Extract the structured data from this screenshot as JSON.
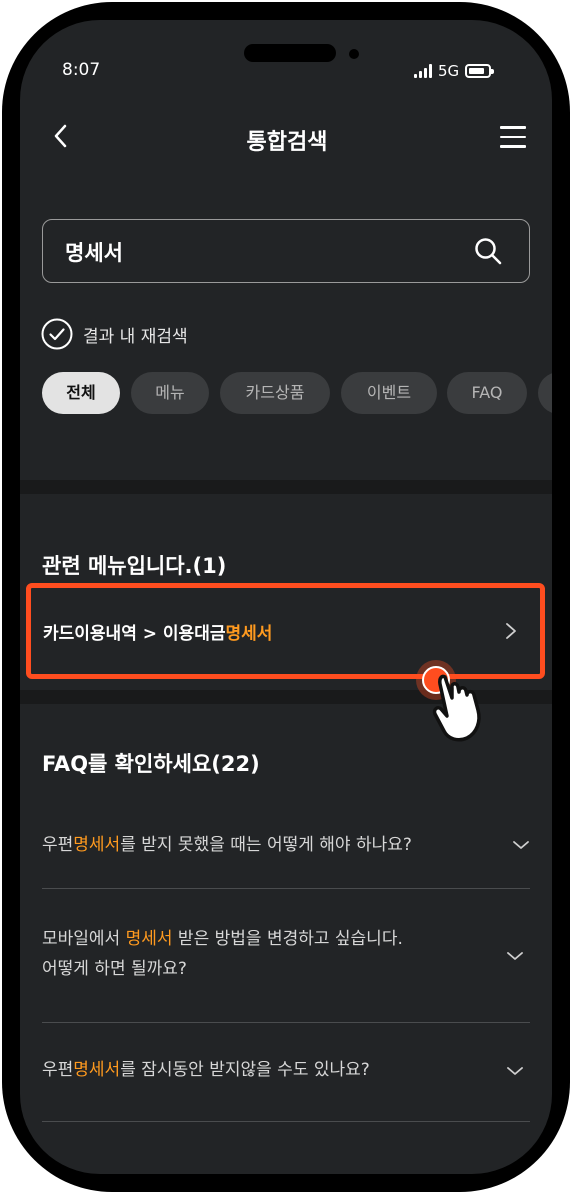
{
  "status": {
    "time": "8:07",
    "network": "5G"
  },
  "header": {
    "title": "통합검색"
  },
  "search": {
    "query": "명세서"
  },
  "recheck": {
    "label": "결과 내 재검색",
    "checked": true
  },
  "chips": [
    {
      "label": "전체",
      "active": true
    },
    {
      "label": "메뉴",
      "active": false
    },
    {
      "label": "카드상품",
      "active": false
    },
    {
      "label": "이벤트",
      "active": false
    },
    {
      "label": "FAQ",
      "active": false
    }
  ],
  "menu_section": {
    "title": "관련 메뉴입니다.(1)",
    "result": {
      "prefix": "카드이용내역 > 이용대금",
      "highlight": "명세서"
    }
  },
  "faq_section": {
    "title": "FAQ를 확인하세요(22)",
    "items": [
      {
        "prefix": "우편",
        "highlight": "명세서",
        "suffix": "를 받지 못했을 때는 어떻게 해야 하나요?"
      },
      {
        "prefix": "모바일에서 ",
        "highlight": "명세서",
        "suffix": " 받은 방법을 변경하고 싶습니다.",
        "line2": "어떻게 하면 될까요?"
      },
      {
        "prefix": "우편",
        "highlight": "명세서",
        "suffix": "를 잠시동안 받지않을 수도 있나요?"
      }
    ]
  },
  "colors": {
    "highlight": "#ff9a1f",
    "focus_border": "#ff4d1f",
    "background": "#222426"
  }
}
